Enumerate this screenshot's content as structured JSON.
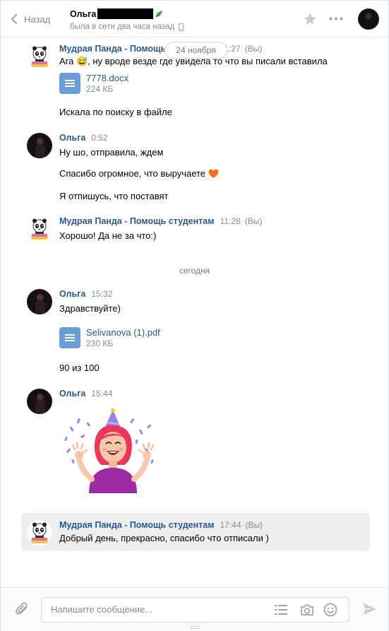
{
  "header": {
    "back_label": "Назад",
    "peer_name": "Ольга",
    "peer_status": "была в сети два часа назад"
  },
  "floating_date": "24 ноября",
  "day_separator": "сегодня",
  "messages": [
    {
      "author": "Мудрая Панда - Помощь студентам",
      "time": "11:27",
      "you": "(Вы)",
      "lines": [
        "Ага 😅, ну вроде везде где увидела то что вы писали вставила"
      ],
      "doc": {
        "name": "7778.docx",
        "size": "224 КБ"
      },
      "extra": "Искала по поиску в файле"
    },
    {
      "author": "Ольга",
      "time": "0:52",
      "lines": [
        "Ну шо, отправила, ждем",
        "Спасибо огромное, что выручаете",
        "Я отпишусь, что поставят"
      ]
    },
    {
      "author": "Мудрая Панда - Помощь студентам",
      "time": "11:28",
      "you": "(Вы)",
      "lines": [
        "Хорошо! Да не за что:)"
      ]
    },
    {
      "author": "Ольга",
      "time": "15:32",
      "lines": [
        "Здравствуйте)"
      ],
      "doc": {
        "name": "Selivanova (1).pdf",
        "size": "230 КБ"
      },
      "extra": "90 из 100"
    },
    {
      "author": "Ольга",
      "time": "15:44",
      "sticker": "celebrating-girl-sticker"
    },
    {
      "author": "Мудрая Панда - Помощь студентам",
      "time": "17:44",
      "you": "(Вы)",
      "lines": [
        "Добрый день, прекрасно, спасибо что отписали )"
      ]
    }
  ],
  "composer": {
    "placeholder": "Напишите сообщение..."
  },
  "colors": {
    "link": "#2a5885",
    "muted": "#818c99",
    "doc_icon": "#6b9ed6",
    "highlight": "#edeef0"
  }
}
